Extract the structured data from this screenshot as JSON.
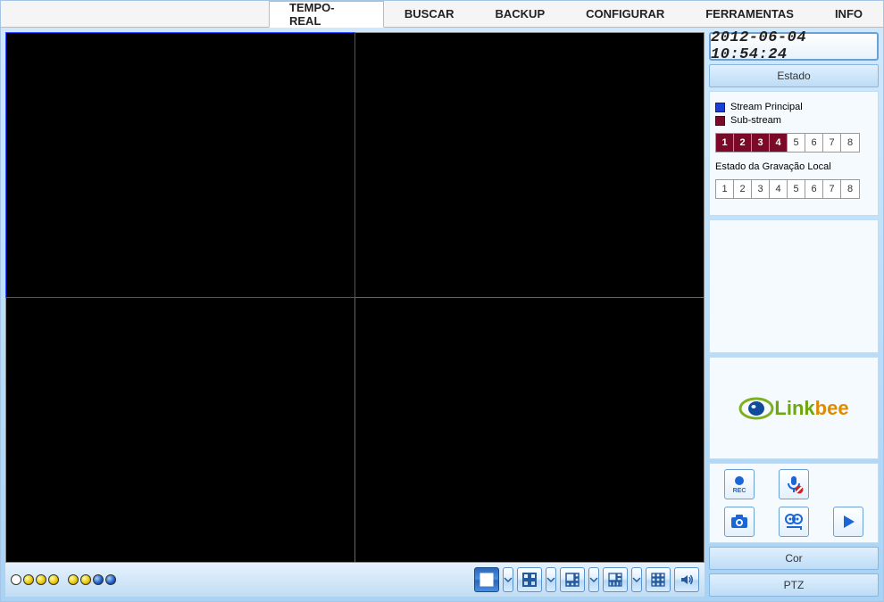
{
  "tabs": [
    {
      "label": "TEMPO-REAL",
      "active": true
    },
    {
      "label": "BUSCAR",
      "active": false
    },
    {
      "label": "BACKUP",
      "active": false
    },
    {
      "label": "CONFIGURAR",
      "active": false
    },
    {
      "label": "FERRAMENTAS",
      "active": false
    },
    {
      "label": "INFO",
      "active": false
    }
  ],
  "datetime": "2012-06-04 10:54:24",
  "side": {
    "estado_label": "Estado",
    "legend_main": "Stream Principal",
    "legend_sub": "Sub-stream",
    "stream_channels": [
      {
        "n": "1",
        "mode": "main"
      },
      {
        "n": "2",
        "mode": "main"
      },
      {
        "n": "3",
        "mode": "main"
      },
      {
        "n": "4",
        "mode": "main"
      },
      {
        "n": "5",
        "mode": "off"
      },
      {
        "n": "6",
        "mode": "off"
      },
      {
        "n": "7",
        "mode": "off"
      },
      {
        "n": "8",
        "mode": "off"
      }
    ],
    "recording_label": "Estado da Gravação Local",
    "recording_channels": [
      "1",
      "2",
      "3",
      "4",
      "5",
      "6",
      "7",
      "8"
    ],
    "cor_label": "Cor",
    "ptz_label": "PTZ",
    "brand_link": "Link",
    "brand_bee": "bee",
    "rec_label": "REC"
  }
}
